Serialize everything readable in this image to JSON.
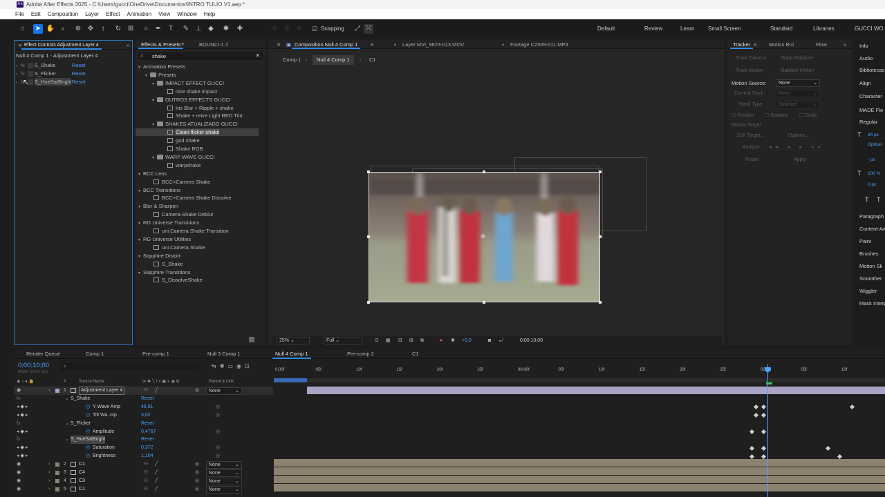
{
  "window": {
    "title": "Adobe After Effects 2025 - C:\\Users\\gucci\\OneDrive\\Documentos\\INTRO TULIO V1.aep *",
    "logo": "Ae"
  },
  "menu": [
    "File",
    "Edit",
    "Composition",
    "Layer",
    "Effect",
    "Animation",
    "View",
    "Window",
    "Help"
  ],
  "toolbar": {
    "snapping_label": "Snapping",
    "workspaces": [
      "Default",
      "Review",
      "Learn",
      "Small Screen",
      "Standard",
      "Libraries",
      "GUCCI WO"
    ]
  },
  "effect_controls": {
    "tab_label": "Effect Controls Adjustment Layer 4",
    "header": "Null 4 Comp 1 - Adjustment Layer 4",
    "effects": [
      {
        "fx": "fx",
        "name": "S_Shake",
        "reset": "Reset"
      },
      {
        "fx": "fx",
        "name": "S_Flicker",
        "reset": "Reset"
      },
      {
        "fx": "fx",
        "name": "S_HueSatBright",
        "reset": "Reset"
      }
    ]
  },
  "effects_presets": {
    "tab_label": "Effects & Presets",
    "tab2_label": "BOUNCI-1.1",
    "search_value": "shake",
    "tree": [
      {
        "level": 0,
        "kind": "folder",
        "label": "Animation Presets"
      },
      {
        "level": 1,
        "kind": "folder",
        "label": "Presets"
      },
      {
        "level": 2,
        "kind": "folder",
        "label": "IMPACT EFFECT GUCCI"
      },
      {
        "level": 3,
        "kind": "preset",
        "label": "nice shake impact"
      },
      {
        "level": 2,
        "kind": "folder",
        "label": "OUTROS EFFECTS GUCCI"
      },
      {
        "level": 3,
        "kind": "preset",
        "label": "Iris Blur + Ripple + shake"
      },
      {
        "level": 3,
        "kind": "preset",
        "label": "Shake + reive Light RED Tint"
      },
      {
        "level": 2,
        "kind": "folder",
        "label": "SHAKES ATUALIZADO GUCCI"
      },
      {
        "level": 3,
        "kind": "preset",
        "label": "Clean flicker shake",
        "selected": true
      },
      {
        "level": 3,
        "kind": "preset",
        "label": "god shake"
      },
      {
        "level": 3,
        "kind": "preset",
        "label": "Shake RGB"
      },
      {
        "level": 2,
        "kind": "folder",
        "label": "WARP WAVE GUCCI"
      },
      {
        "level": 3,
        "kind": "preset",
        "label": "warpshake"
      },
      {
        "level": 0,
        "kind": "folder",
        "label": "BCC Lens"
      },
      {
        "level": 1,
        "kind": "preset",
        "label": "BCC+Camera Shake"
      },
      {
        "level": 0,
        "kind": "folder",
        "label": "BCC Transitions"
      },
      {
        "level": 1,
        "kind": "preset",
        "label": "BCC+Camera Shake Dissolve"
      },
      {
        "level": 0,
        "kind": "folder",
        "label": "Blur & Sharpen"
      },
      {
        "level": 1,
        "kind": "preset",
        "label": "Camera-Shake Deblur"
      },
      {
        "level": 0,
        "kind": "folder",
        "label": "RG Universe Transitions"
      },
      {
        "level": 1,
        "kind": "preset",
        "label": "uni.Camera Shake Transition"
      },
      {
        "level": 0,
        "kind": "folder",
        "label": "RG Universe Utilities"
      },
      {
        "level": 1,
        "kind": "preset",
        "label": "uni.Camera Shake"
      },
      {
        "level": 0,
        "kind": "folder",
        "label": "Sapphire Distort"
      },
      {
        "level": 1,
        "kind": "preset",
        "label": "S_Shake"
      },
      {
        "level": 0,
        "kind": "folder",
        "label": "Sapphire Transitions"
      },
      {
        "level": 1,
        "kind": "preset",
        "label": "S_DissolveShake"
      }
    ]
  },
  "composition": {
    "tabs": [
      "Composition Null 4 Comp 1",
      "Layer MVI_9823-013.MOV",
      "Footage C2509-011.MP4"
    ],
    "breadcrumbs": [
      "Comp 1",
      "Null 4 Comp 1",
      "C1"
    ],
    "zoom": "25%",
    "resolution": "Full",
    "exposure": "+0,0",
    "timecode": "0;00;10;00"
  },
  "tracker": {
    "tabs": [
      "Tracker",
      "Motion Bro",
      "Flow"
    ],
    "buttons": [
      "Track Camera",
      "Warp Stabilizer",
      "Track Motion",
      "Stabilize Motion"
    ],
    "motion_source_label": "Motion Source:",
    "motion_source_value": "None",
    "current_track_label": "Current Track:",
    "current_track_value": "None",
    "track_type_label": "Track Type:",
    "track_type_value": "Stabilize",
    "checks": [
      "Position",
      "Rotation",
      "Scale"
    ],
    "motion_target_label": "Motion Target:",
    "edit_target": "Edit Target...",
    "options": "Options...",
    "analyze_label": "Analyze:",
    "reset": "Reset",
    "apply": "Apply"
  },
  "side_panel": {
    "items": [
      "Info",
      "Audio",
      "Bibliotecas",
      "Align",
      "Character",
      "MADE Flo",
      "Regular",
      "84 px",
      "Optical",
      "- px",
      "100 %",
      "0 px",
      "Paragraph",
      "Content-Aw",
      "Paint",
      "Brushes",
      "Motion Sk",
      "Smoother",
      "Wiggler",
      "Mask Interp"
    ]
  },
  "timeline": {
    "tabs": [
      "Render Queue",
      "Comp 1",
      "Pre-comp 1",
      "Null 3 Comp 1",
      "Null 4 Comp 1",
      "Pre-comp 2",
      "C1"
    ],
    "timecode": "0;00;10;00",
    "fps_label": "00300 (29.97 fps)",
    "col_source": "Source Name",
    "col_parent": "Parent & Link",
    "ruler": [
      "0;00f",
      "05f",
      "10f",
      "15f",
      "20f",
      "25f",
      "00;00f",
      "05f",
      "10f",
      "15f",
      "20f",
      "25f",
      "00f",
      "05f",
      "10f"
    ],
    "layers": [
      {
        "type": "layer",
        "num": "1",
        "name": "Adjustment Layer 4",
        "parent": "None"
      },
      {
        "type": "effect",
        "name": "S_Shake",
        "reset": "Reset"
      },
      {
        "type": "prop",
        "name": "Y Wave Amp",
        "value": "45,81"
      },
      {
        "type": "prop",
        "name": "Tilt Wa..mp",
        "value": "3,02"
      },
      {
        "type": "effect",
        "name": "S_Flicker",
        "reset": "Reset"
      },
      {
        "type": "prop",
        "name": "Amplitude",
        "value": "0,4767"
      },
      {
        "type": "effect",
        "name": "S_HueSatBright",
        "reset": "Reset"
      },
      {
        "type": "prop",
        "name": "Saturation",
        "value": "0,372"
      },
      {
        "type": "prop",
        "name": "Brightness",
        "value": "1,104"
      },
      {
        "type": "layer",
        "num": "2",
        "name": "C1",
        "parent": "None"
      },
      {
        "type": "layer",
        "num": "3",
        "name": "C4",
        "parent": "None"
      },
      {
        "type": "layer",
        "num": "4",
        "name": "C3",
        "parent": "None"
      },
      {
        "type": "layer",
        "num": "5",
        "name": "C1",
        "parent": "None"
      }
    ]
  },
  "colors": {
    "accent": "#2d8ceb",
    "value_blue": "#4aa3ff",
    "adjustment_bar": "#a9a4c4",
    "footage_bar": "#8d8270"
  }
}
